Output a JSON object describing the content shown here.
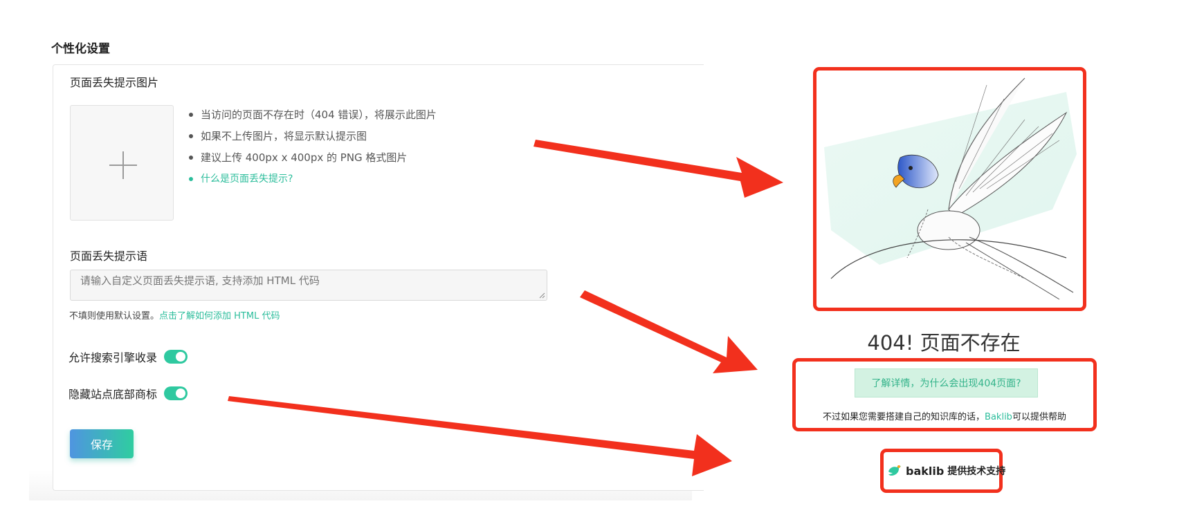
{
  "settings": {
    "section_title": "个性化设置",
    "image_label": "页面丢失提示图片",
    "tips": [
      "当访问的页面不存在时（404 错误），将展示此图片",
      "如果不上传图片，将显示默认提示图",
      "建议上传 400px x 400px 的 PNG 格式图片"
    ],
    "tip_link": "什么是页面丢失提示?",
    "message_label": "页面丢失提示语",
    "message_placeholder": "请输入自定义页面丢失提示语, 支持添加 HTML 代码",
    "hint_text": "不填则使用默认设置。",
    "hint_link": "点击了解如何添加 HTML 代码",
    "toggle_search": "允许搜索引擎收录",
    "toggle_footer": "隐藏站点底部商标",
    "save_label": "保存",
    "toggles_on": [
      true,
      true
    ]
  },
  "preview": {
    "title": "404! 页面不存在",
    "detail_button": "了解详情，为什么会出现404页面?",
    "help_prefix": "不过如果您需要搭建自己的知识库的话，",
    "help_brand": "Baklib",
    "help_suffix": "可以提供帮助",
    "powered_logo": "baklib",
    "powered_text": "提供技术支持"
  },
  "colors": {
    "accent": "#2bbd9b",
    "highlight_red": "#f2301d",
    "toggle": "#2fc9a0"
  }
}
